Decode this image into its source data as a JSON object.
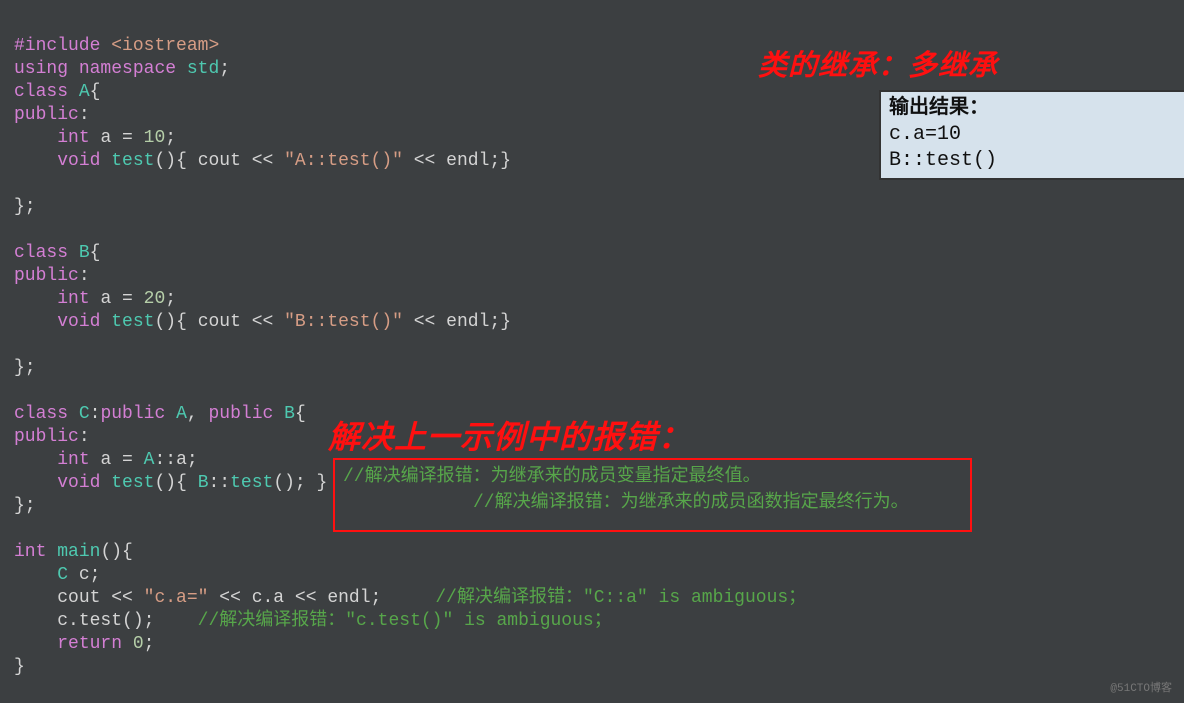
{
  "title_top": "类的继承：多继承",
  "title_mid": "解决上一示例中的报错：",
  "output": {
    "header": "输出结果：",
    "lines": [
      "c.a=10",
      "B::test()"
    ]
  },
  "redbox": {
    "line1": "//解决编译报错：为继承来的成员变量指定最终值。",
    "line2": "//解决编译报错：为继承来的成员函数指定最终行为。"
  },
  "code": {
    "l1_a": "#include",
    "l1_b": "<iostream>",
    "l2_a": "using",
    "l2_b": "namespace",
    "l2_c": "std",
    "l3_a": "class",
    "l3_b": "A",
    "l4": "public",
    "l5_a": "int",
    "l5_b": "a",
    "l5_c": "10",
    "l6_a": "void",
    "l6_b": "test",
    "l6_c": "cout",
    "l6_d": "\"A::test()\"",
    "l6_e": "endl",
    "l10_a": "class",
    "l10_b": "B",
    "l11": "public",
    "l12_a": "int",
    "l12_b": "a",
    "l12_c": "20",
    "l13_a": "void",
    "l13_b": "test",
    "l13_c": "cout",
    "l13_d": "\"B::test()\"",
    "l13_e": "endl",
    "l17_a": "class",
    "l17_b": "C",
    "l17_c": "public",
    "l17_d": "A",
    "l17_e": "public",
    "l17_f": "B",
    "l18": "public",
    "l19_a": "int",
    "l19_b": "a",
    "l19_c": "A",
    "l19_d": "a",
    "l20_a": "void",
    "l20_b": "test",
    "l20_c": "B",
    "l20_d": "test",
    "l23_a": "int",
    "l23_b": "main",
    "l24": "C c",
    "l25_a": "cout",
    "l25_b": "\"c.a=\"",
    "l25_c": "c.a",
    "l25_d": "endl",
    "l25_cm": "//解决编译报错：\"C::a\" is ambiguous；",
    "l26_a": "c.test",
    "l26_cm": "//解决编译报错：\"c.test()\" is ambiguous；",
    "l27_a": "return",
    "l27_b": "0"
  },
  "watermark": "@51CTO博客"
}
